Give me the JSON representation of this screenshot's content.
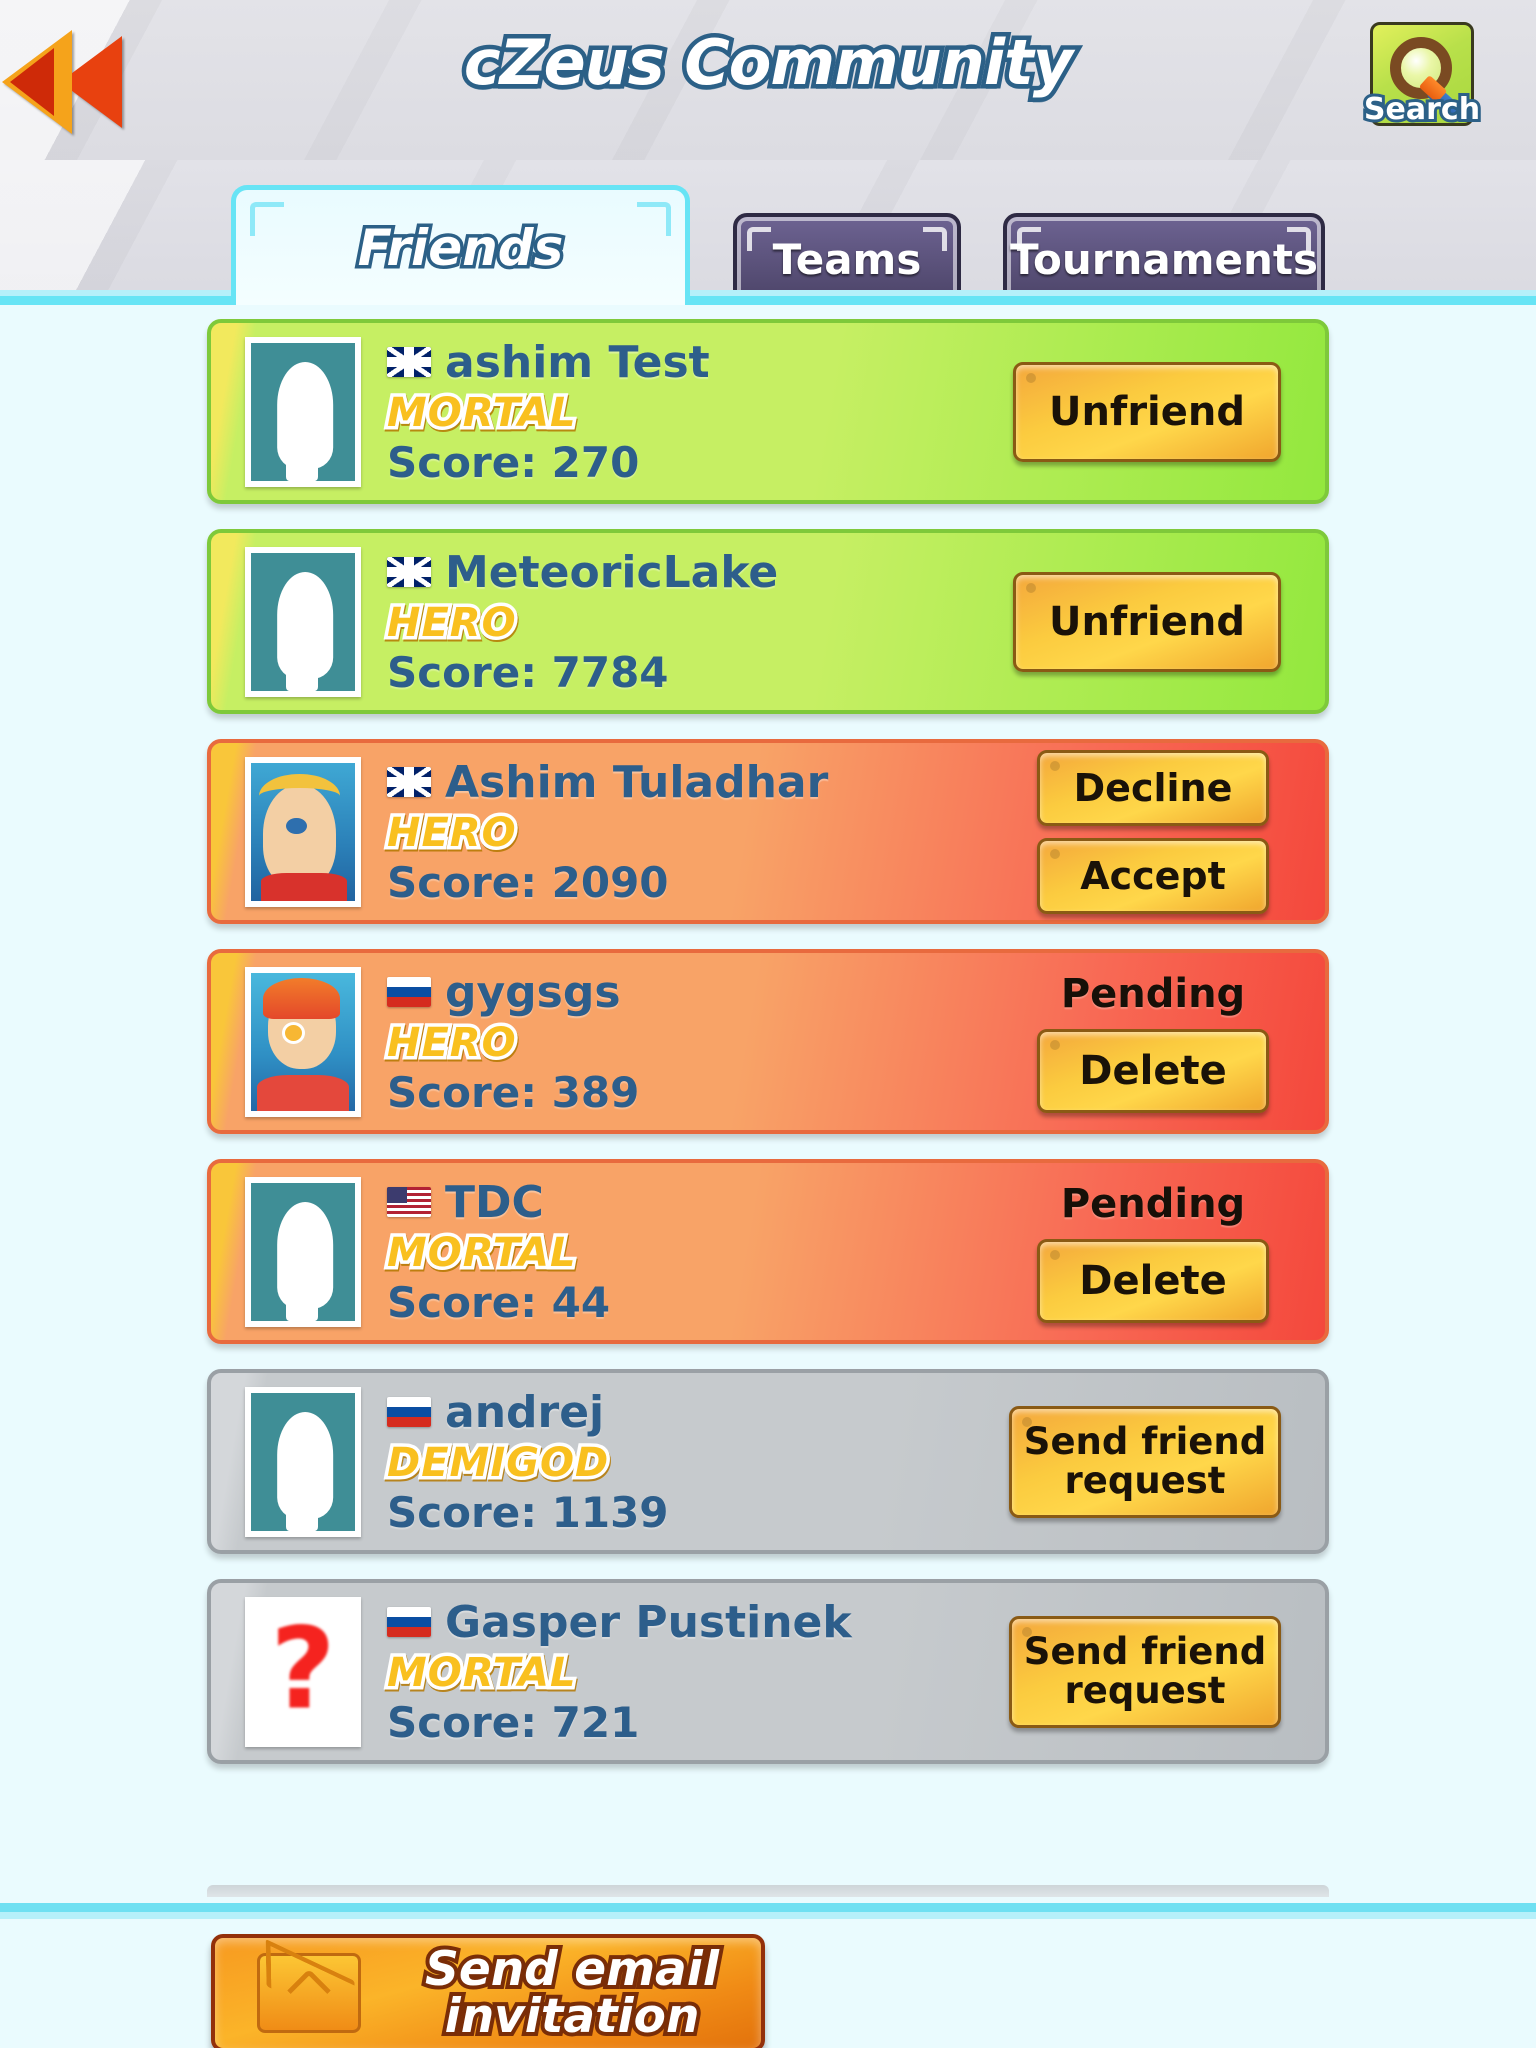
{
  "header": {
    "title": "cZeus Community",
    "back_icon": "back-arrow-icon",
    "search_label": "Search",
    "search_icon": "magnifier-icon"
  },
  "tabs": [
    {
      "label": "Friends",
      "active": true
    },
    {
      "label": "Teams",
      "active": false
    },
    {
      "label": "Tournaments",
      "active": false
    }
  ],
  "list": {
    "score_prefix": "Score: ",
    "rows": [
      {
        "name": "ashim Test",
        "rank": "MORTAL",
        "score": "Score: 270",
        "flag": "gb",
        "avatar": "silhouette",
        "theme": "green",
        "status": "",
        "buttons": [
          {
            "label": "Unfriend",
            "kind": "unfriend"
          }
        ]
      },
      {
        "name": "MeteoricLake",
        "rank": "HERO",
        "score": "Score: 7784",
        "flag": "gb",
        "avatar": "silhouette",
        "theme": "green",
        "status": "",
        "buttons": [
          {
            "label": "Unfriend",
            "kind": "unfriend"
          }
        ]
      },
      {
        "name": "Ashim Tuladhar",
        "rank": "HERO",
        "score": "Score: 2090",
        "flag": "gb",
        "avatar": "hero-male",
        "theme": "orange",
        "status": "",
        "buttons": [
          {
            "label": "Decline",
            "kind": "small"
          },
          {
            "label": "Accept",
            "kind": "small"
          }
        ]
      },
      {
        "name": "gygsgs",
        "rank": "HERO",
        "score": "Score: 389",
        "flag": "si",
        "avatar": "hero-female",
        "theme": "orange",
        "status": "Pending",
        "buttons": [
          {
            "label": "Delete",
            "kind": "delete"
          }
        ]
      },
      {
        "name": "TDC",
        "rank": "MORTAL",
        "score": "Score: 44",
        "flag": "us",
        "avatar": "silhouette",
        "theme": "orange",
        "status": "Pending",
        "buttons": [
          {
            "label": "Delete",
            "kind": "delete"
          }
        ]
      },
      {
        "name": "andrej",
        "rank": "DEMIGOD",
        "score": "Score: 1139",
        "flag": "si",
        "avatar": "silhouette",
        "theme": "gray",
        "status": "",
        "buttons": [
          {
            "label": "Send friend request",
            "kind": "sendreq"
          }
        ]
      },
      {
        "name": "Gasper Pustinek",
        "rank": "MORTAL",
        "score": "Score: 721",
        "flag": "si",
        "avatar": "question",
        "theme": "gray",
        "status": "",
        "buttons": [
          {
            "label": "Send friend request",
            "kind": "sendreq"
          }
        ]
      }
    ]
  },
  "footer": {
    "email_invitation_label": "Send email invitation",
    "envelope_icon": "envelope-icon"
  },
  "colors": {
    "accent_cyan": "#67e4f5",
    "title_outline": "#2c6087",
    "name_text": "#2d5e8b",
    "rank_gold": "#f9c01f",
    "green_row": "#c6ef63",
    "orange_row": "#f8a367",
    "gray_row": "#c6cacd",
    "button_gold": "#ffd74a",
    "email_orange": "#fbb429"
  }
}
